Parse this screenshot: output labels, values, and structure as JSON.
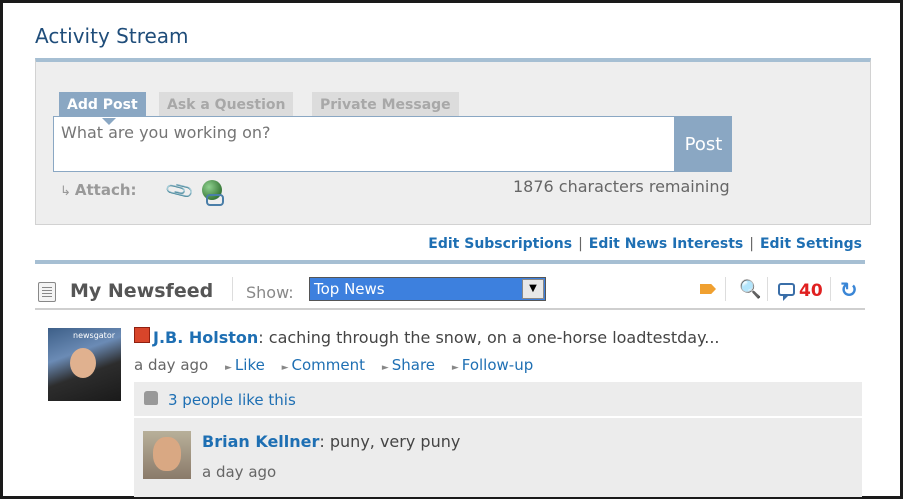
{
  "page": {
    "title": "Activity Stream"
  },
  "composer": {
    "tabs": [
      {
        "label": "Add Post",
        "active": true
      },
      {
        "label": "Ask a Question",
        "active": false
      },
      {
        "label": "Private Message",
        "active": false
      }
    ],
    "placeholder": "What are you working on?",
    "post_label": "Post",
    "attach_arrow": "↳",
    "attach_label": "Attach:",
    "chars_remaining": "1876 characters remaining"
  },
  "edit_links": {
    "subscriptions": "Edit Subscriptions",
    "news_interests": "Edit News Interests",
    "settings": "Edit Settings",
    "separator": "|"
  },
  "newsfeed": {
    "title": "My Newsfeed",
    "show_label": "Show:",
    "show_value": "Top News",
    "comment_count": "40",
    "avatar_logo": "newsgator"
  },
  "post": {
    "author": "J.B. Holston",
    "text": ": caching through the snow, on a one-horse loadtestday...",
    "time": "a day ago",
    "actions": {
      "like": "Like",
      "comment": "Comment",
      "share": "Share",
      "follow": "Follow-up"
    },
    "likes": "3 people like this"
  },
  "comment": {
    "author": "Brian Kellner",
    "text": ": puny, very puny",
    "time": "a day ago"
  },
  "colors": {
    "accent": "#8aa7c3",
    "link": "#1e6fb3",
    "select": "#3d80de",
    "count_red": "#e02020"
  }
}
